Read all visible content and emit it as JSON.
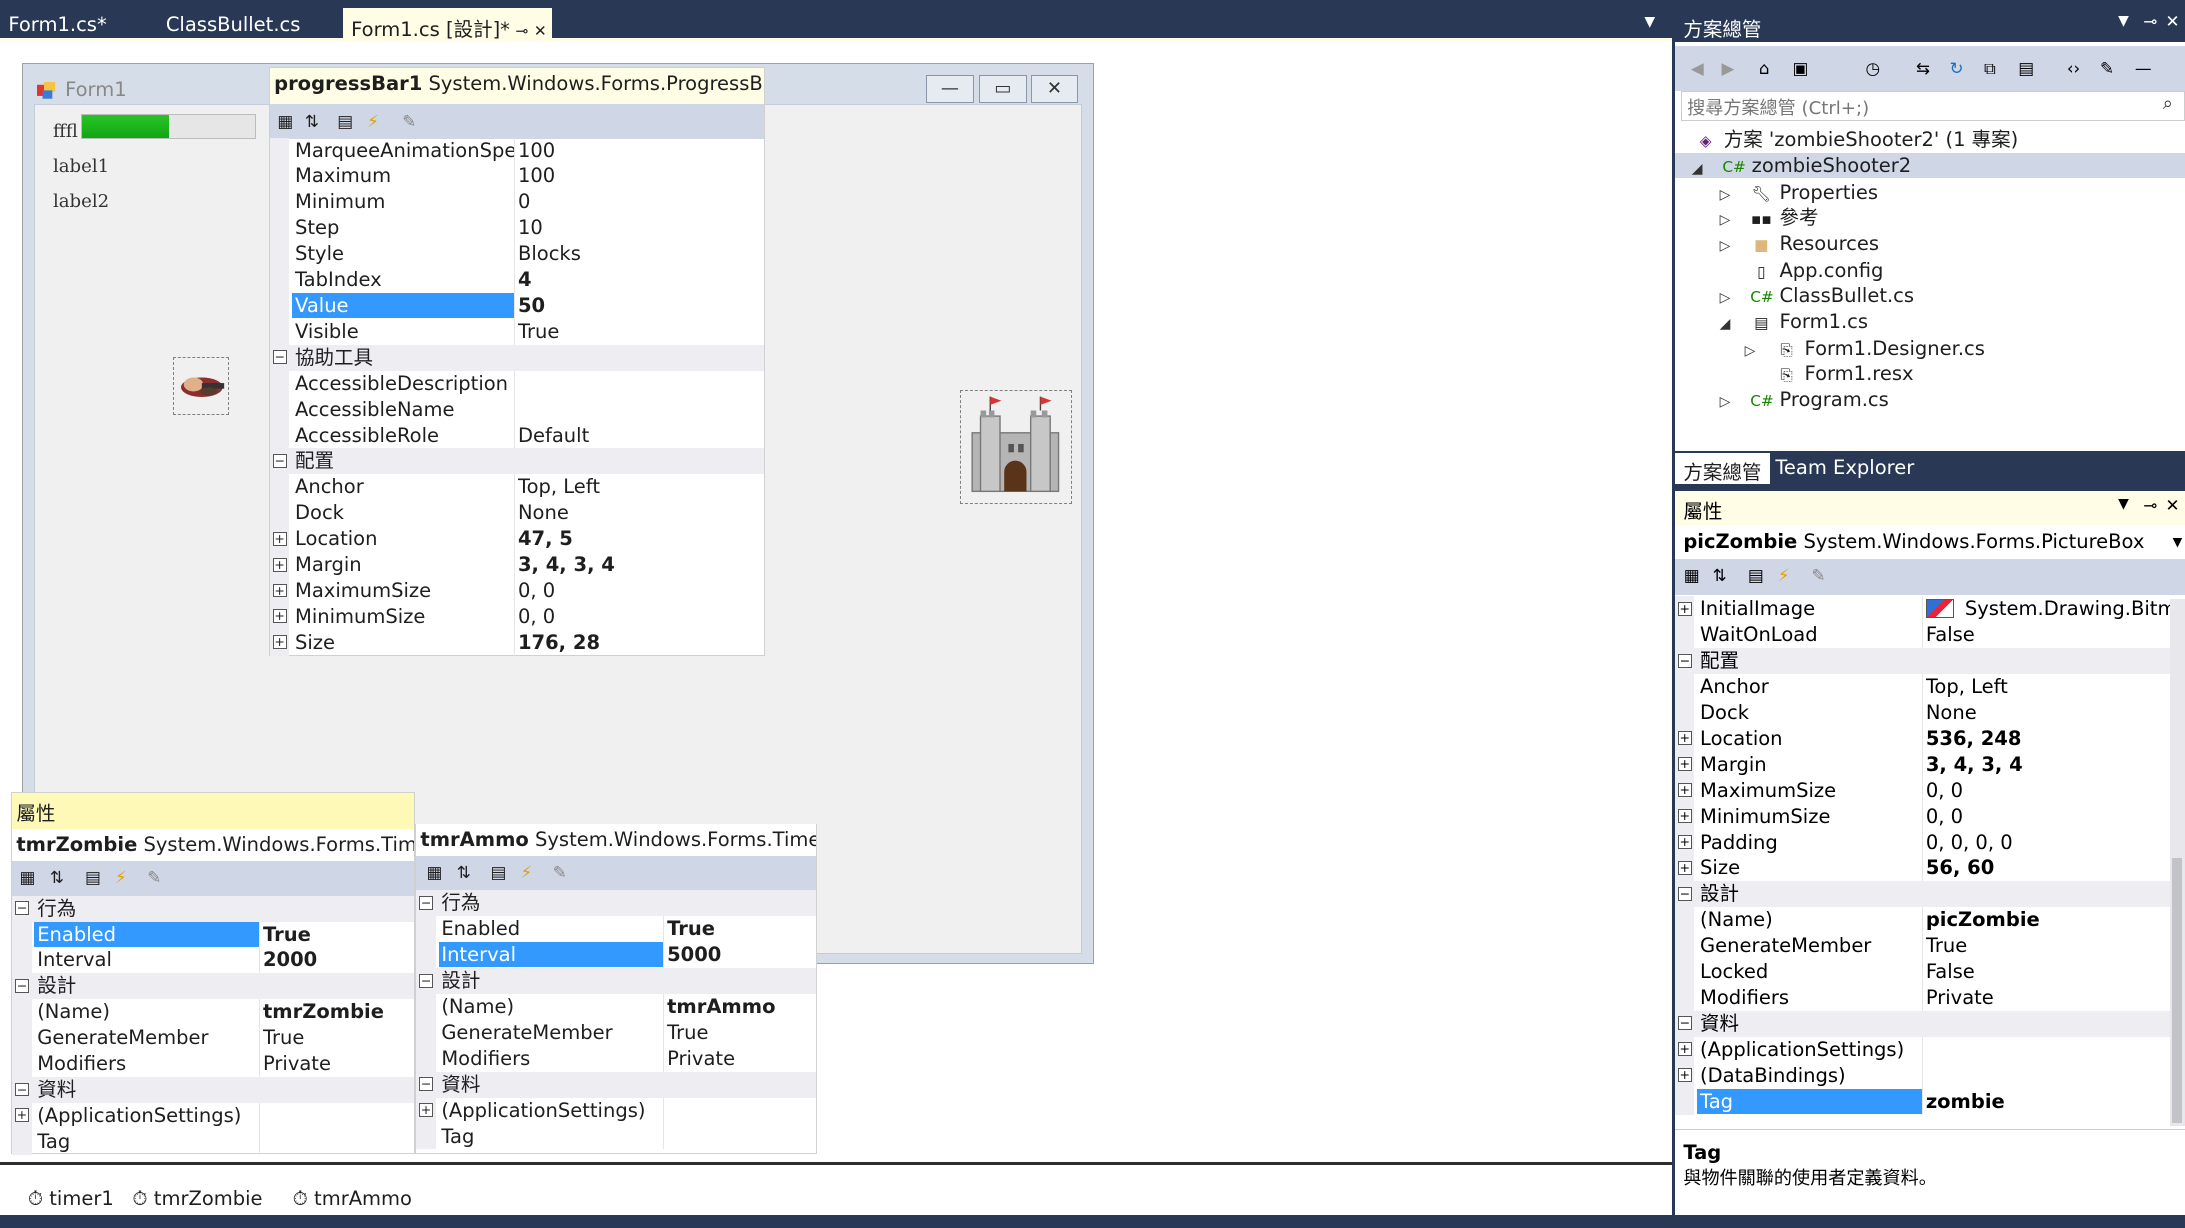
{
  "tabs": [
    {
      "label": "Form1.cs*",
      "active": false
    },
    {
      "label": "ClassBullet.cs",
      "active": false
    },
    {
      "label": "Form1.cs [設計]*",
      "active": true
    }
  ],
  "form": {
    "title": "Form1",
    "label_fill": "fffl",
    "label1": "label1",
    "label2": "label2",
    "progress_value": 0.5
  },
  "progress_props": {
    "object_name": "progressBar1",
    "type": "System.Windows.Forms.ProgressBar",
    "rows": [
      {
        "n": "MarqueeAnimationSpeed",
        "v": "100"
      },
      {
        "n": "Maximum",
        "v": "100"
      },
      {
        "n": "Minimum",
        "v": "0"
      },
      {
        "n": "Step",
        "v": "10"
      },
      {
        "n": "Style",
        "v": "Blocks"
      },
      {
        "n": "TabIndex",
        "v": "4"
      },
      {
        "n": "Value",
        "v": "50"
      },
      {
        "n": "Visible",
        "v": "True"
      },
      {
        "cat": "協助工具"
      },
      {
        "n": "AccessibleDescription",
        "v": ""
      },
      {
        "n": "AccessibleName",
        "v": ""
      },
      {
        "n": "AccessibleRole",
        "v": "Default"
      },
      {
        "cat": "配置"
      },
      {
        "n": "Anchor",
        "v": "Top, Left"
      },
      {
        "n": "Dock",
        "v": "None"
      },
      {
        "n": "Location",
        "v": "47, 5"
      },
      {
        "n": "Margin",
        "v": "3, 4, 3, 4"
      },
      {
        "n": "MaximumSize",
        "v": "0, 0"
      },
      {
        "n": "MinimumSize",
        "v": "0, 0"
      },
      {
        "n": "Size",
        "v": "176, 28"
      }
    ]
  },
  "zombie_panel": {
    "header": "屬性",
    "object_name": "tmrZombie",
    "type": "System.Windows.Forms.Timer",
    "rows": [
      {
        "cat": "行為"
      },
      {
        "n": "Enabled",
        "v": "True"
      },
      {
        "n": "Interval",
        "v": "2000"
      },
      {
        "cat": "設計"
      },
      {
        "n": "(Name)",
        "v": "tmrZombie"
      },
      {
        "n": "GenerateMember",
        "v": "True"
      },
      {
        "n": "Modifiers",
        "v": "Private"
      },
      {
        "cat": "資料"
      },
      {
        "n": "(ApplicationSettings)",
        "v": ""
      },
      {
        "n": "Tag",
        "v": ""
      }
    ]
  },
  "ammo_panel": {
    "object_name": "tmrAmmo",
    "type": "System.Windows.Forms.Timer",
    "rows": [
      {
        "cat": "行為"
      },
      {
        "n": "Enabled",
        "v": "True"
      },
      {
        "n": "Interval",
        "v": "5000"
      },
      {
        "cat": "設計"
      },
      {
        "n": "(Name)",
        "v": "tmrAmmo"
      },
      {
        "n": "GenerateMember",
        "v": "True"
      },
      {
        "n": "Modifiers",
        "v": "Private"
      },
      {
        "cat": "資料"
      },
      {
        "n": "(ApplicationSettings)",
        "v": ""
      },
      {
        "n": "Tag",
        "v": ""
      }
    ]
  },
  "tray": [
    "timer1",
    "tmrZombie",
    "tmrAmmo"
  ],
  "solution_explorer": {
    "title": "方案總管",
    "search_placeholder": "搜尋方案總管 (Ctrl+;)",
    "items": [
      {
        "label": "方案 'zombieShooter2' (1 專案)",
        "icon": "solution-icon"
      },
      {
        "label": "zombieShooter2",
        "icon": "csharp-project-icon"
      },
      {
        "label": "Properties",
        "icon": "wrench-icon"
      },
      {
        "label": "參考",
        "icon": "references-icon"
      },
      {
        "label": "Resources",
        "icon": "folder-icon"
      },
      {
        "label": "App.config",
        "icon": "config-icon"
      },
      {
        "label": "ClassBullet.cs",
        "icon": "csharp-file-icon"
      },
      {
        "label": "Form1.cs",
        "icon": "form-icon"
      },
      {
        "label": "Form1.Designer.cs",
        "icon": "designer-file-icon"
      },
      {
        "label": "Form1.resx",
        "icon": "resx-file-icon"
      },
      {
        "label": "Program.cs",
        "icon": "csharp-file-icon"
      }
    ],
    "tab_solution": "方案總管",
    "tab_team": "Team Explorer"
  },
  "right_props": {
    "title": "屬性",
    "object_name": "picZombie",
    "type": "System.Windows.Forms.PictureBox",
    "rows": [
      {
        "n": "InitialImage",
        "v": "System.Drawing.Bitmap"
      },
      {
        "n": "WaitOnLoad",
        "v": "False"
      },
      {
        "cat": "配置"
      },
      {
        "n": "Anchor",
        "v": "Top, Left"
      },
      {
        "n": "Dock",
        "v": "None"
      },
      {
        "n": "Location",
        "v": "536, 248"
      },
      {
        "n": "Margin",
        "v": "3, 4, 3, 4"
      },
      {
        "n": "MaximumSize",
        "v": "0, 0"
      },
      {
        "n": "MinimumSize",
        "v": "0, 0"
      },
      {
        "n": "Padding",
        "v": "0, 0, 0, 0"
      },
      {
        "n": "Size",
        "v": "56, 60"
      },
      {
        "cat": "設計"
      },
      {
        "n": "(Name)",
        "v": "picZombie"
      },
      {
        "n": "GenerateMember",
        "v": "True"
      },
      {
        "n": "Locked",
        "v": "False"
      },
      {
        "n": "Modifiers",
        "v": "Private"
      },
      {
        "cat": "資料"
      },
      {
        "n": "(ApplicationSettings)",
        "v": ""
      },
      {
        "n": "(DataBindings)",
        "v": ""
      },
      {
        "n": "Tag",
        "v": "zombie"
      }
    ],
    "desc_title": "Tag",
    "desc_text": "與物件關聯的使用者定義資料。"
  },
  "colors": {
    "selection": "#3399ff",
    "background": "#293955",
    "header": "#fffde6",
    "progress": "#12a512"
  }
}
